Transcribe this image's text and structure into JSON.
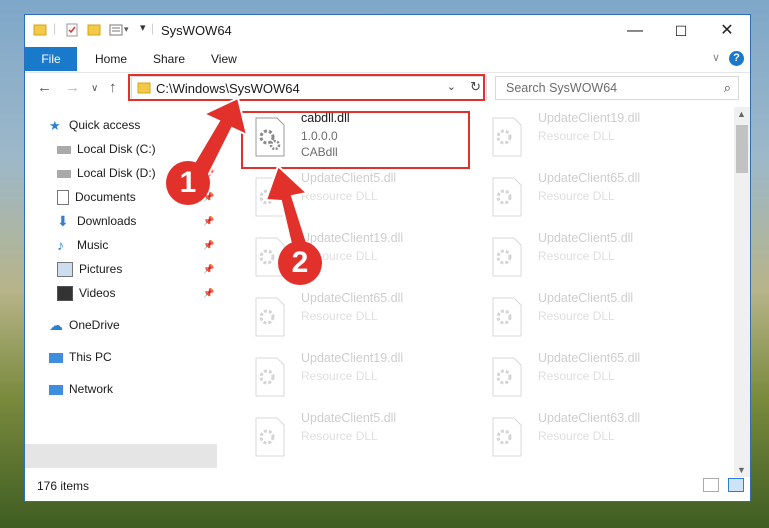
{
  "window": {
    "title": "SysWOW64",
    "controls": [
      "—",
      "☐",
      "✕"
    ]
  },
  "ribbon": {
    "file": "File",
    "tabs": [
      "Home",
      "Share",
      "View"
    ],
    "help": "?"
  },
  "address": {
    "path": "C:\\Windows\\SysWOW64",
    "search_placeholder": "Search SysWOW64"
  },
  "nav": {
    "quick_access": "Quick access",
    "items": [
      "Local Disk (C:)",
      "Local Disk (D:)",
      "Documents",
      "Downloads",
      "Music",
      "Pictures",
      "Videos"
    ],
    "onedrive": "OneDrive",
    "this_pc": "This PC",
    "network": "Network"
  },
  "files": [
    {
      "name": "cabdll.dll",
      "line1": "1.0.0.0",
      "line2": "CABdll"
    },
    {
      "name": "UpdateClient19.dll",
      "line1": "Resource DLL"
    },
    {
      "name": "UpdateClient5.dll",
      "line1": "Resource DLL"
    },
    {
      "name": "UpdateClient65.dll",
      "line1": "Resource DLL"
    },
    {
      "name": "UpdateClient19.dll",
      "line1": "Resource DLL"
    },
    {
      "name": "UpdateClient5.dll",
      "line1": "Resource DLL"
    },
    {
      "name": "UpdateClient65.dll",
      "line1": "Resource DLL"
    },
    {
      "name": "UpdateClient5.dll",
      "line1": "Resource DLL"
    },
    {
      "name": "UpdateClient19.dll",
      "line1": "Resource DLL"
    },
    {
      "name": "UpdateClient65.dll",
      "line1": "Resource DLL"
    },
    {
      "name": "UpdateClient5.dll",
      "line1": "Resource DLL"
    },
    {
      "name": "UpdateClient63.dll",
      "line1": "Resource DLL"
    }
  ],
  "status": {
    "items": "176 items"
  },
  "annotations": {
    "badge1": "1",
    "badge2": "2"
  },
  "colors": {
    "accent": "#1979ca",
    "annotation": "#e2302b",
    "folder": "#f3c94a"
  }
}
